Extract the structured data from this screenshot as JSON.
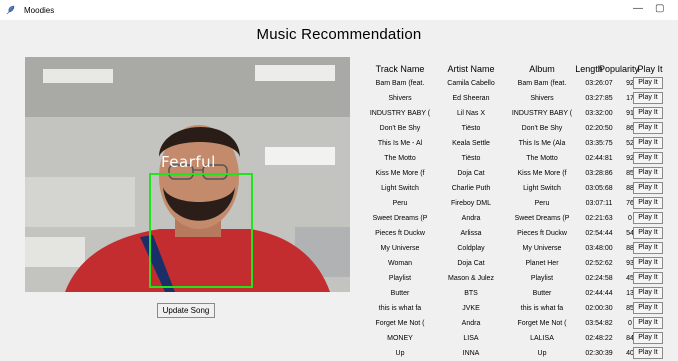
{
  "window": {
    "title": "Moodies",
    "minimize": "—",
    "maximize": "▢"
  },
  "heading": "Music Recommendation",
  "camera": {
    "emotion": "Fearful"
  },
  "update_button": "Update Song",
  "columns": [
    "Track Name",
    "Artist Name",
    "Album",
    "Length",
    "Popularity",
    "Play It"
  ],
  "rows": [
    {
      "track": "Bam Bam (feat.",
      "artist": "Camila Cabello",
      "album": "Bam Bam (feat.",
      "length": "03:26:07",
      "popularity": "92",
      "play": "Play It"
    },
    {
      "track": "Shivers",
      "artist": "Ed Sheeran",
      "album": "Shivers",
      "length": "03:27:85",
      "popularity": "17",
      "play": "Play It"
    },
    {
      "track": "INDUSTRY BABY (",
      "artist": "Lil Nas X",
      "album": "INDUSTRY BABY (",
      "length": "03:32:00",
      "popularity": "91",
      "play": "Play It"
    },
    {
      "track": "Don't Be Shy",
      "artist": "Tiësto",
      "album": "Don't Be Shy",
      "length": "02:20:50",
      "popularity": "86",
      "play": "Play It"
    },
    {
      "track": "This Is Me - Al",
      "artist": "Keala Settle",
      "album": "This Is Me (Ala",
      "length": "03:35:75",
      "popularity": "52",
      "play": "Play It"
    },
    {
      "track": "The Motto",
      "artist": "Tiësto",
      "album": "The Motto",
      "length": "02:44:81",
      "popularity": "92",
      "play": "Play It"
    },
    {
      "track": "Kiss Me More (f",
      "artist": "Doja Cat",
      "album": "Kiss Me More (f",
      "length": "03:28:86",
      "popularity": "85",
      "play": "Play It"
    },
    {
      "track": "Light Switch",
      "artist": "Charlie Puth",
      "album": "Light Switch",
      "length": "03:05:68",
      "popularity": "88",
      "play": "Play It"
    },
    {
      "track": "Peru",
      "artist": "Fireboy DML",
      "album": "Peru",
      "length": "03:07:11",
      "popularity": "76",
      "play": "Play It"
    },
    {
      "track": "Sweet Dreams (P",
      "artist": "Andra",
      "album": "Sweet Dreams (P",
      "length": "02:21:63",
      "popularity": "0",
      "play": "Play It"
    },
    {
      "track": "Pieces ft Duckw",
      "artist": "Arlissa",
      "album": "Pieces ft Duckw",
      "length": "02:54:44",
      "popularity": "54",
      "play": "Play It"
    },
    {
      "track": "My Universe",
      "artist": "Coldplay",
      "album": "My Universe",
      "length": "03:48:00",
      "popularity": "88",
      "play": "Play It"
    },
    {
      "track": "Woman",
      "artist": "Doja Cat",
      "album": "Planet Her",
      "length": "02:52:62",
      "popularity": "93",
      "play": "Play It"
    },
    {
      "track": "Playlist",
      "artist": "Mason & Julez",
      "album": "Playlist",
      "length": "02:24:58",
      "popularity": "45",
      "play": "Play It"
    },
    {
      "track": "Butter",
      "artist": "BTS",
      "album": "Butter",
      "length": "02:44:44",
      "popularity": "13",
      "play": "Play It"
    },
    {
      "track": "this is what fa",
      "artist": "JVKE",
      "album": "this is what fa",
      "length": "02:00:30",
      "popularity": "85",
      "play": "Play It"
    },
    {
      "track": "Forget Me Not (",
      "artist": "Andra",
      "album": "Forget Me Not (",
      "length": "03:54:82",
      "popularity": "0",
      "play": "Play It"
    },
    {
      "track": "MONEY",
      "artist": "LISA",
      "album": "LALISA",
      "length": "02:48:22",
      "popularity": "84",
      "play": "Play It"
    },
    {
      "track": "Up",
      "artist": "INNA",
      "album": "Up",
      "length": "02:30:39",
      "popularity": "40",
      "play": "Play It"
    }
  ]
}
